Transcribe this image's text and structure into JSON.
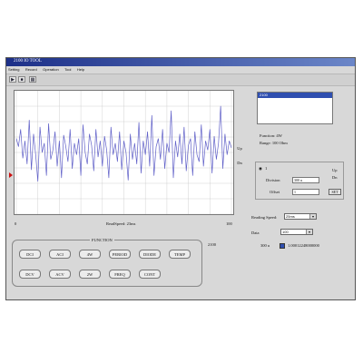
{
  "window": {
    "title": "2100 IO TOOL"
  },
  "menu": [
    "Setting",
    "Record",
    "Operation",
    "Tool",
    "Help"
  ],
  "toolbar": {
    "play_icon": "play-icon",
    "stop_icon": "stop-icon",
    "grid_icon": "grid-icon"
  },
  "plot": {
    "x_start": "0",
    "x_end": "100",
    "read_speed_label": "ReadSpeed: 23ms",
    "up_label": "Up",
    "dn_label": "Dn"
  },
  "listbox": {
    "selected": "2100"
  },
  "info": {
    "function": "Function: 4W",
    "range": "Range: 100 Ohm"
  },
  "scale": {
    "option": "1",
    "division_label": "Division",
    "division_value": "300 u",
    "offset_label": "Offset",
    "offset_value": "1",
    "up_label": "Up",
    "dn_label": "Dn",
    "set_label": "SET"
  },
  "reading": {
    "speed_label": "Reading Speed:",
    "speed_value": "25ms",
    "data_label": "Data",
    "data_value": "100",
    "unit_label": "300 u",
    "reading_value": "1.00012248000000"
  },
  "function_panel": {
    "title": "FUNCTION",
    "device_label": "2100",
    "buttons": [
      "DCI",
      "ACI",
      "4W",
      "PERIOD",
      "DIODE",
      "TEMP",
      "DCV",
      "ACV",
      "2W",
      "FREQ",
      "CONT"
    ]
  },
  "colors": {
    "trace": "#6060c8",
    "titlebar": "#1c2f88",
    "marker": "#cc1111"
  },
  "chart_data": {
    "type": "line",
    "xlim": [
      0,
      100
    ],
    "ylim": [
      0,
      100
    ],
    "grid": true,
    "series": [
      {
        "x": [
          0,
          1,
          2,
          3,
          4,
          5,
          6,
          7,
          8,
          9,
          10,
          11,
          12,
          13,
          14,
          15,
          16,
          17,
          18,
          19,
          20,
          21,
          22,
          23,
          24,
          25,
          26,
          27,
          28,
          29,
          30,
          31,
          32,
          33,
          34,
          35,
          36,
          37,
          38,
          39,
          40,
          41,
          42,
          43,
          44,
          45,
          46,
          47,
          48,
          49,
          50,
          51,
          52,
          53,
          54,
          55,
          56,
          57,
          58,
          59,
          60,
          61,
          62,
          63,
          64,
          65,
          66,
          67,
          68,
          69,
          70,
          71,
          72,
          73,
          74,
          75,
          76,
          77,
          78,
          79,
          80,
          81,
          82,
          83,
          84,
          85,
          86,
          87,
          88,
          89,
          90,
          91,
          92,
          93,
          94,
          95,
          96,
          97,
          98,
          99,
          100
        ],
        "y": [
          62,
          55,
          70,
          45,
          60,
          40,
          78,
          35,
          66,
          48,
          25,
          72,
          50,
          58,
          30,
          75,
          44,
          52,
          68,
          38,
          60,
          28,
          65,
          55,
          42,
          70,
          36,
          58,
          48,
          62,
          30,
          74,
          50,
          40,
          66,
          56,
          34,
          70,
          46,
          60,
          38,
          64,
          52,
          28,
          72,
          48,
          58,
          42,
          68,
          35,
          60,
          50,
          26,
          66,
          44,
          58,
          40,
          76,
          32,
          60,
          48,
          68,
          38,
          82,
          30,
          55,
          62,
          44,
          70,
          36,
          58,
          50,
          86,
          28,
          60,
          46,
          66,
          40,
          72,
          34,
          56,
          62,
          30,
          68,
          48,
          42,
          74,
          38,
          60,
          52,
          70,
          32,
          64,
          44,
          58,
          90,
          36,
          66,
          48,
          60,
          54
        ]
      }
    ]
  }
}
